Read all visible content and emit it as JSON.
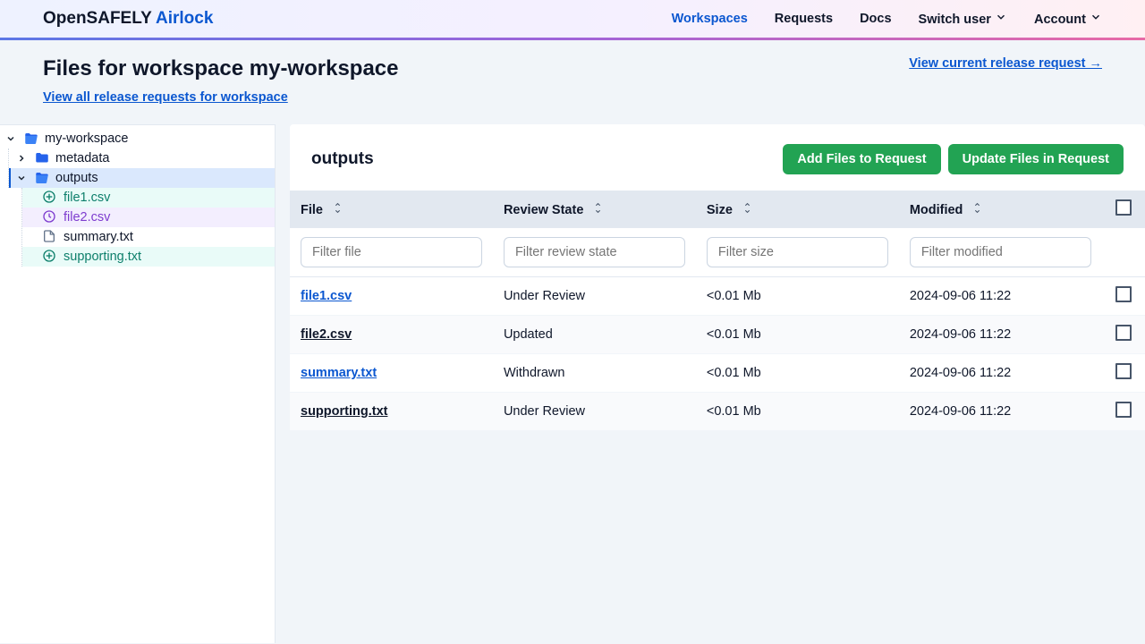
{
  "brand": {
    "a": "OpenSAFELY ",
    "b": "Airlock"
  },
  "nav": {
    "workspaces": "Workspaces",
    "requests": "Requests",
    "docs": "Docs",
    "switch_user": "Switch user",
    "account": "Account"
  },
  "header": {
    "title": "Files for workspace my-workspace",
    "all_requests": "View all release requests for workspace",
    "current_request": "View current release request →"
  },
  "tree": {
    "root": "my-workspace",
    "folders": [
      {
        "name": "metadata"
      },
      {
        "name": "outputs",
        "open": true,
        "selected": true,
        "files": [
          {
            "name": "file1.csv",
            "state": "added",
            "kind": "plus"
          },
          {
            "name": "file2.csv",
            "state": "updated",
            "kind": "refresh"
          },
          {
            "name": "summary.txt",
            "state": "plain",
            "kind": "file"
          },
          {
            "name": "supporting.txt",
            "state": "added",
            "kind": "plus"
          }
        ]
      }
    ]
  },
  "panel": {
    "title": "outputs",
    "btn_add": "Add Files to Request",
    "btn_update": "Update Files in Request"
  },
  "columns": {
    "file": "File",
    "review": "Review State",
    "size": "Size",
    "modified": "Modified"
  },
  "filters": {
    "file": "Filter file",
    "review": "Filter review state",
    "size": "Filter size",
    "modified": "Filter modified"
  },
  "rows": [
    {
      "file": "file1.csv",
      "review": "Under Review",
      "size": "<0.01 Mb",
      "modified": "2024-09-06 11:22",
      "plain": false
    },
    {
      "file": "file2.csv",
      "review": "Updated",
      "size": "<0.01 Mb",
      "modified": "2024-09-06 11:22",
      "plain": true
    },
    {
      "file": "summary.txt",
      "review": "Withdrawn",
      "size": "<0.01 Mb",
      "modified": "2024-09-06 11:22",
      "plain": false
    },
    {
      "file": "supporting.txt",
      "review": "Under Review",
      "size": "<0.01 Mb",
      "modified": "2024-09-06 11:22",
      "plain": true
    }
  ]
}
